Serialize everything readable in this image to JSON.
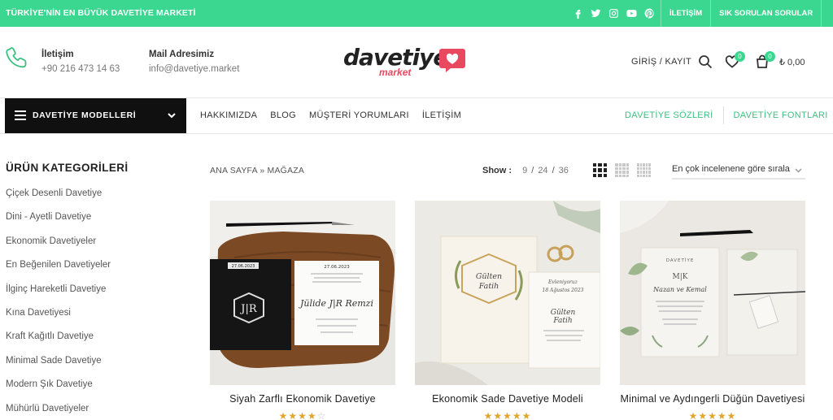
{
  "topbar": {
    "promo": "TÜRKİYE'NİN EN BÜYÜK DAVETİYE MARKETİ",
    "links": [
      "İLETİŞİM",
      "SIK SORULAN SORULAR"
    ],
    "social_icons": [
      "facebook-icon",
      "twitter-icon",
      "instagram-icon",
      "youtube-icon",
      "pinterest-icon"
    ]
  },
  "header": {
    "phone_label": "İletişim",
    "phone_value": "+90 216 473 14 63",
    "mail_label": "Mail Adresimiz",
    "mail_value": "info@davetiye.market",
    "logo_word": "davetiye",
    "logo_sub": "market",
    "login": "GİRİŞ / KAYIT",
    "wishlist_count": "0",
    "cart_count": "0",
    "cart_total": "₺ 0,00"
  },
  "nav": {
    "category_button": "DAVETİYE MODELLERİ",
    "links": [
      "HAKKIMIZDA",
      "BLOG",
      "MÜŞTERİ YORUMLARI",
      "İLETİŞİM"
    ],
    "right_links": [
      "DAVETİYE SÖZLERİ",
      "DAVETİYE FONTLARI"
    ]
  },
  "sidebar": {
    "title": "ÜRÜN KATEGORİLERİ",
    "items": [
      "Çiçek Desenli Davetiye",
      "Dini - Ayetli Davetiye",
      "Ekonomik Davetiyeler",
      "En Beğenilen Davetiyeler",
      "İlginç Hareketli Davetiye",
      "Kına Davetiyesi",
      "Kraft Kağıtlı Davetiye",
      "Minimal Sade Davetiye",
      "Modern Şık Davetiye",
      "Mühürlü Davetiyeler"
    ]
  },
  "toolbar": {
    "breadcrumb": "ANA SAYFA » MAĞAZA",
    "show_label": "Show :",
    "show_options": [
      "9",
      "24",
      "36"
    ],
    "sort": "En çok incelenene göre sırala"
  },
  "products": [
    {
      "name": "Siyah Zarflı Ekonomik Davetiye",
      "rating": 4,
      "card_date": "27.06.2023",
      "card_names": "Jülide | JR | Remzi",
      "monogram": "J|R"
    },
    {
      "name": "Ekonomik Sade Davetiye Modeli",
      "rating": 5,
      "card_names": "Gülten Fatih",
      "card_date": "18 Ağustos 2023"
    },
    {
      "name": "Minimal ve Aydıngerli Düğün Davetiyesi",
      "rating": 5,
      "card_title": "DAVETİYE",
      "monogram": "M|K",
      "card_names": "Nazan ve Kemal"
    }
  ],
  "colors": {
    "accent": "#3bd68f",
    "nav_accent": "#3bc17f",
    "logo_red": "#e8495f",
    "star": "#e0a52e"
  }
}
